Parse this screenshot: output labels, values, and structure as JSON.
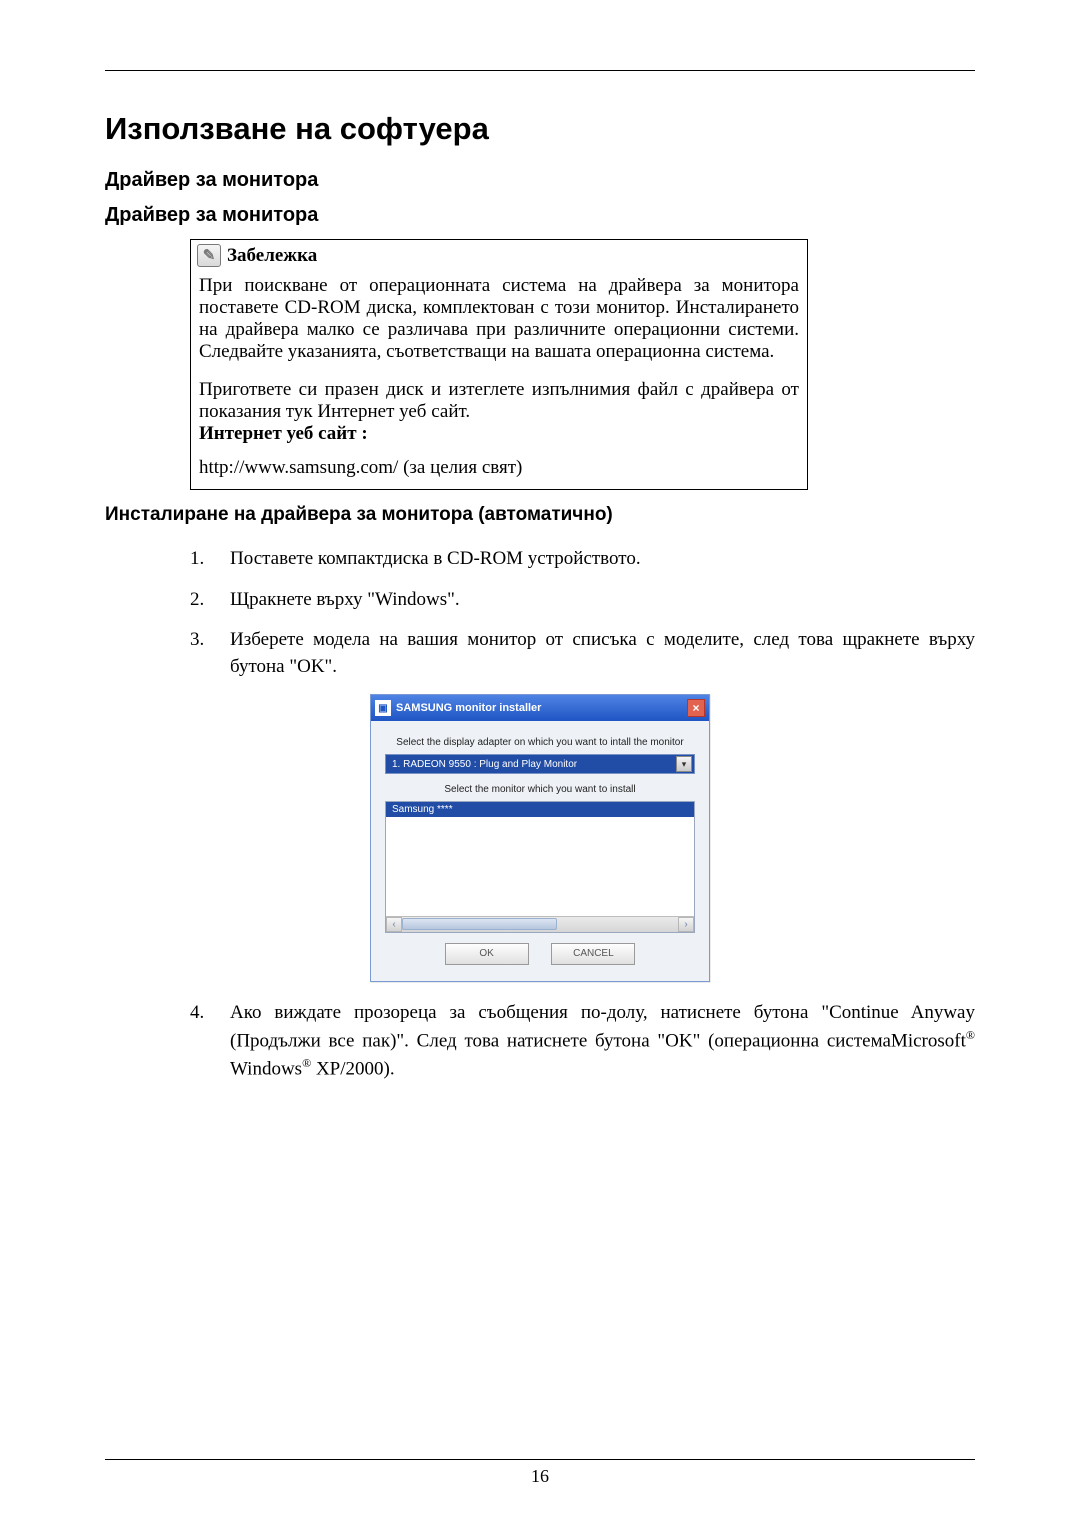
{
  "page": {
    "title": "Използване на софтуера",
    "heading1": "Драйвер за монитора",
    "heading2": "Драйвер за монитора",
    "heading3": "Инсталиране на драйвера за монитора (автоматично)",
    "pagenum": "16"
  },
  "note": {
    "label": "Забележка",
    "para1": "При поискване от операционната система на драйвера за монитора поставете CD-ROM диска, комплектован с този монитор. Инсталирането на драйвера малко се различава при различните операционни системи. Следвайте указанията, съответстващи на вашата операционна система.",
    "para2": "Пригответе си празен диск и изтеглете изпълнимия файл с драйвера от показания тук Интернет уеб сайт.",
    "site_label": "Интернет уеб сайт :",
    "url": "http://www.samsung.com/ (за целия свят)"
  },
  "steps": {
    "s1_num": "1.",
    "s1_txt": "Поставете компактдиска в CD-ROM устройството.",
    "s2_num": "2.",
    "s2_txt": "Щракнете върху \"Windows\".",
    "s3_num": "3.",
    "s3_txt": "Изберете модела на вашия монитор от списъка с моделите, след това щракнете върху бутона \"OK\".",
    "s4_num": "4.",
    "s4_before": "Ако виждате прозореца за съобщения по-долу, натиснете бутона \"Continue Anyway (Продължи все пак)\". След това натиснете бутона \"OK\" (операционна системаMicrosoft",
    "s4_mid": " Windows",
    "s4_after": " XP/2000).",
    "reg": "®"
  },
  "dialog": {
    "title": "SAMSUNG monitor installer",
    "label1": "Select the display adapter on which you want to intall the monitor",
    "adapter": "1. RADEON 9550 : Plug and Play Monitor",
    "label2": "Select the monitor which you want to install",
    "list_item": "Samsung ****",
    "ok": "OK",
    "cancel": "CANCEL"
  }
}
